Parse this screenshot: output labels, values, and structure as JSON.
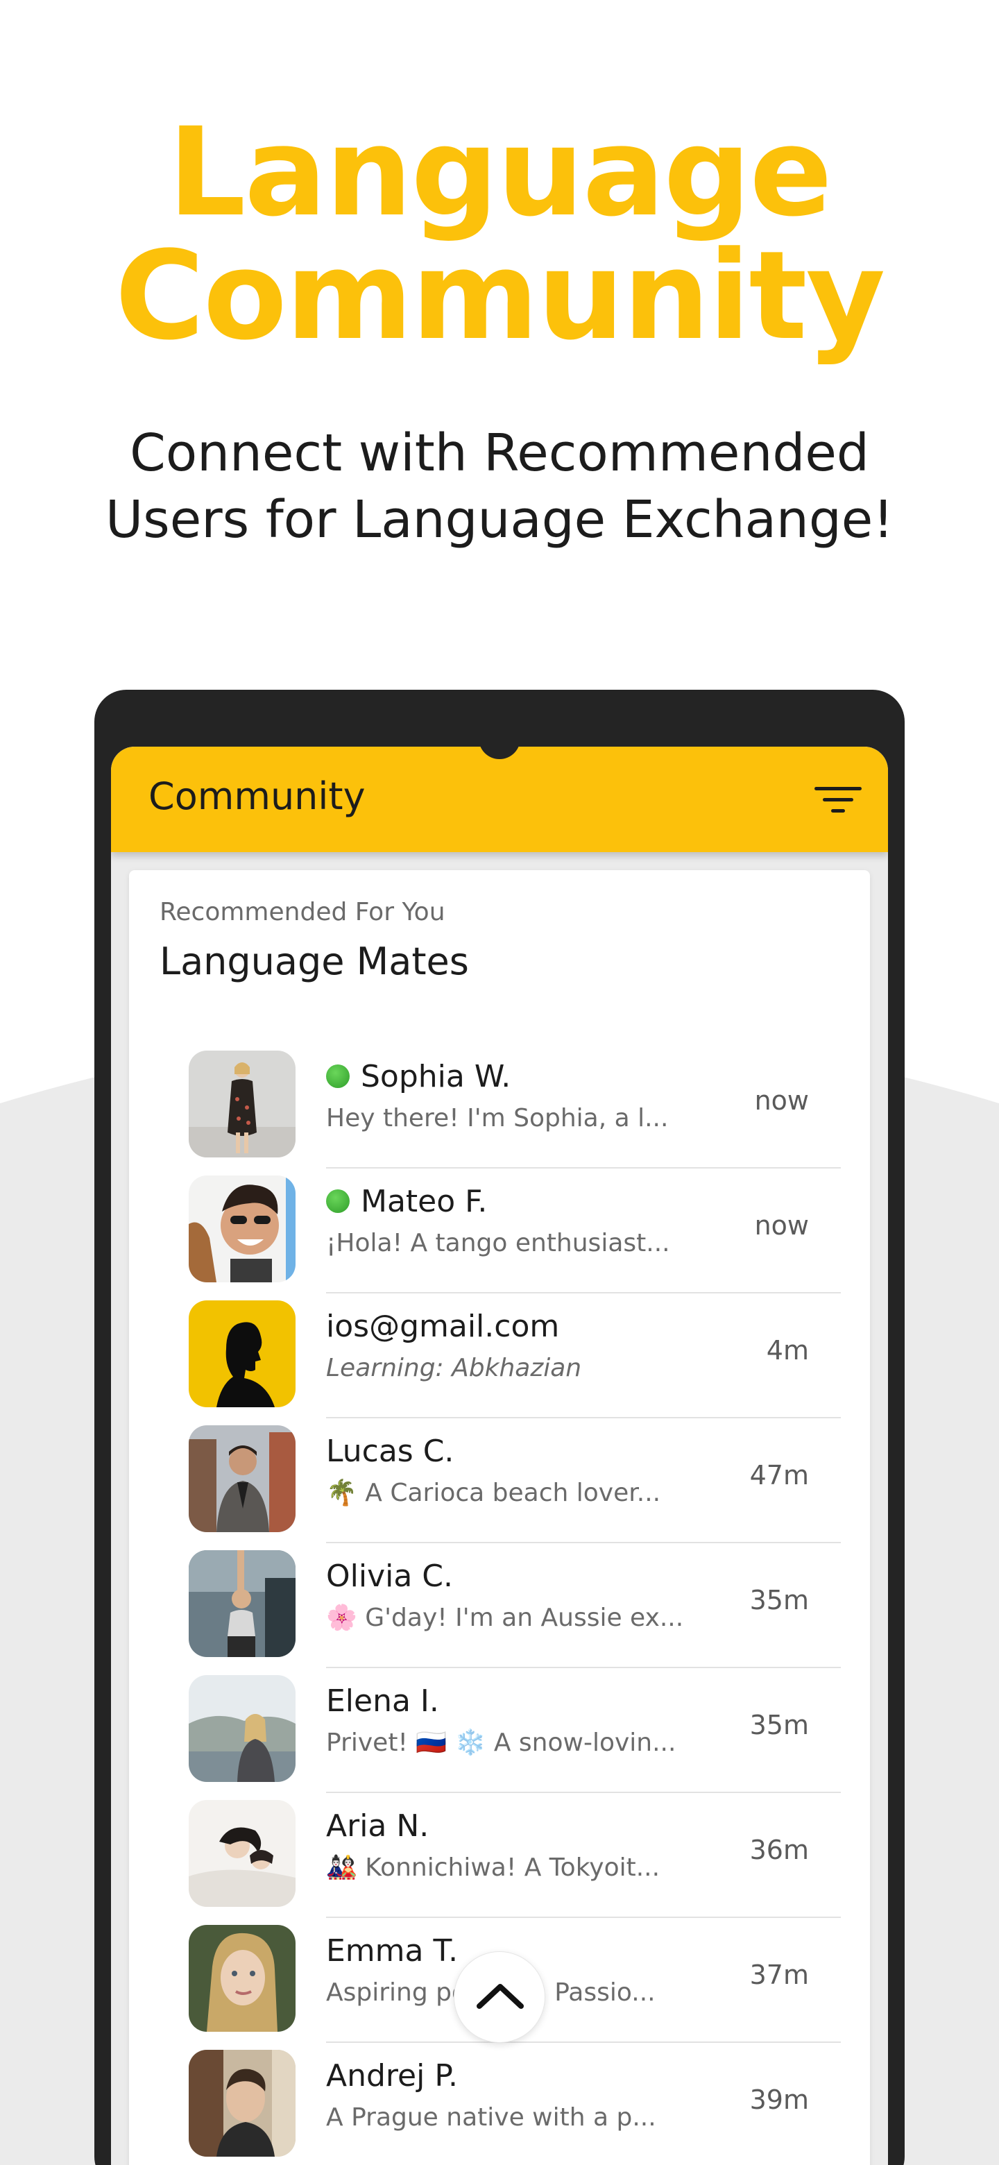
{
  "hero": {
    "title_line1": "Language",
    "title_line2": "Community",
    "subtitle_line1": "Connect with Recommended",
    "subtitle_line2": "Users for Language Exchange!"
  },
  "appbar": {
    "title": "Community",
    "filter_icon": "filter-icon"
  },
  "card": {
    "kicker": "Recommended For You",
    "title": "Language Mates"
  },
  "users": [
    {
      "name": "Sophia W.",
      "snippet": "Hey there! I'm Sophia, a l...",
      "time": "now",
      "online": true
    },
    {
      "name": "Mateo F.",
      "snippet": "¡Hola! A tango enthusiast...",
      "time": "now",
      "online": true
    },
    {
      "name": "ios@gmail.com",
      "snippet": "Learning: Abkhazian",
      "time": "4m",
      "online": false
    },
    {
      "name": "Lucas C.",
      "snippet": "🌴 A Carioca beach lover...",
      "time": "47m",
      "online": false
    },
    {
      "name": "Olivia C.",
      "snippet": "🌸 G'day! I'm an Aussie ex...",
      "time": "35m",
      "online": false
    },
    {
      "name": "Elena I.",
      "snippet": "Privet! 🇷🇺 ❄️ A snow-lovin...",
      "time": "35m",
      "online": false
    },
    {
      "name": "Aria N.",
      "snippet": "🎎 Konnichiwa! A Tokyoit...",
      "time": "36m",
      "online": false
    },
    {
      "name": "Emma T.",
      "snippet": "Aspiring polyglot! Passio...",
      "time": "37m",
      "online": false
    },
    {
      "name": "Andrej P.",
      "snippet": "A Prague native with a p...",
      "time": "39m",
      "online": false
    }
  ],
  "scroll_top_icon": "chevron-up-icon",
  "colors": {
    "accent": "#fcc10b",
    "frame": "#242424",
    "online": "#3aa832"
  }
}
